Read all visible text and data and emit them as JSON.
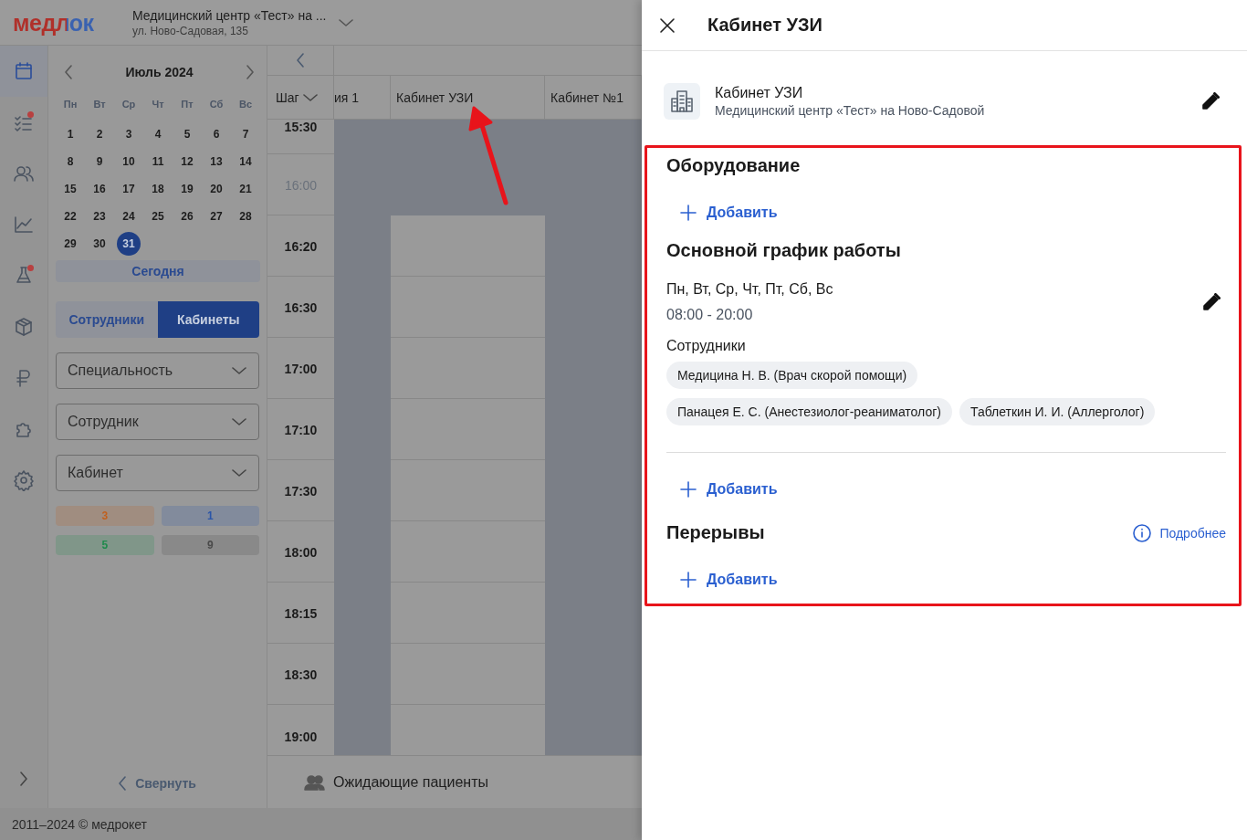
{
  "header": {
    "logo": "медлок",
    "clinic": "Медицинский центр «Тест» на ...",
    "address": "ул. Ново-Садовая, 135"
  },
  "nav_rail": [
    {
      "kind": "calendar",
      "selected": true,
      "notification": false
    },
    {
      "kind": "tasks",
      "selected": false,
      "notification": true
    },
    {
      "kind": "people",
      "selected": false,
      "notification": false
    },
    {
      "kind": "chart",
      "selected": false,
      "notification": false
    },
    {
      "kind": "flask",
      "selected": false,
      "notification": true
    },
    {
      "kind": "box",
      "selected": false,
      "notification": false
    },
    {
      "kind": "ruble",
      "selected": false,
      "notification": false
    },
    {
      "kind": "puzzle",
      "selected": false,
      "notification": false
    },
    {
      "kind": "gear",
      "selected": false,
      "notification": false
    }
  ],
  "calendar": {
    "month": "Июль 2024",
    "weekdays": [
      "Пн",
      "Вт",
      "Ср",
      "Чт",
      "Пт",
      "Сб",
      "Вс"
    ],
    "days": [
      {
        "day": "1",
        "selected": false
      },
      {
        "day": "2",
        "selected": false
      },
      {
        "day": "3",
        "selected": false
      },
      {
        "day": "4",
        "selected": false
      },
      {
        "day": "5",
        "selected": false
      },
      {
        "day": "6",
        "selected": false
      },
      {
        "day": "7",
        "selected": false
      },
      {
        "day": "8",
        "selected": false
      },
      {
        "day": "9",
        "selected": false
      },
      {
        "day": "10",
        "selected": false
      },
      {
        "day": "11",
        "selected": false
      },
      {
        "day": "12",
        "selected": false
      },
      {
        "day": "13",
        "selected": false
      },
      {
        "day": "14",
        "selected": false
      },
      {
        "day": "15",
        "selected": false
      },
      {
        "day": "16",
        "selected": false
      },
      {
        "day": "17",
        "selected": false
      },
      {
        "day": "18",
        "selected": false
      },
      {
        "day": "19",
        "selected": false
      },
      {
        "day": "20",
        "selected": false
      },
      {
        "day": "21",
        "selected": false
      },
      {
        "day": "22",
        "selected": false
      },
      {
        "day": "23",
        "selected": false
      },
      {
        "day": "24",
        "selected": false
      },
      {
        "day": "25",
        "selected": false
      },
      {
        "day": "26",
        "selected": false
      },
      {
        "day": "27",
        "selected": false
      },
      {
        "day": "28",
        "selected": false
      },
      {
        "day": "29",
        "selected": false
      },
      {
        "day": "30",
        "selected": false
      },
      {
        "day": "31",
        "selected": true
      }
    ],
    "today_button": "Сегодня"
  },
  "view_tabs": [
    {
      "label": "Сотрудники",
      "selected": false
    },
    {
      "label": "Кабинеты",
      "selected": true
    }
  ],
  "filters": [
    {
      "placeholder": "Специальность"
    },
    {
      "placeholder": "Сотрудник"
    },
    {
      "placeholder": "Кабинет"
    }
  ],
  "counters": [
    {
      "value": "3",
      "color": "#c0601e"
    },
    {
      "value": "1",
      "color": "#2a55a8"
    },
    {
      "value": "5",
      "color": "#1f8a4c"
    },
    {
      "value": "9",
      "color": "#4a4a4a"
    }
  ],
  "collapse_button": "Свернуть",
  "schedule": {
    "step": "Шаг",
    "columns": [
      "ия 1",
      "Кабинет УЗИ",
      "Кабинет №1"
    ],
    "rows": [
      {
        "time": "15:30",
        "minor": false,
        "available": [
          false,
          false,
          false
        ]
      },
      {
        "time": "16:00",
        "minor": true,
        "available": [
          false,
          false,
          false
        ]
      },
      {
        "time": "16:20",
        "minor": false,
        "available": [
          false,
          true,
          false
        ]
      },
      {
        "time": "16:30",
        "minor": false,
        "available": [
          false,
          true,
          false
        ]
      },
      {
        "time": "17:00",
        "minor": false,
        "available": [
          false,
          true,
          false
        ]
      },
      {
        "time": "17:10",
        "minor": false,
        "available": [
          false,
          true,
          false
        ]
      },
      {
        "time": "17:30",
        "minor": false,
        "available": [
          false,
          true,
          false
        ]
      },
      {
        "time": "18:00",
        "minor": false,
        "available": [
          false,
          true,
          false
        ]
      },
      {
        "time": "18:15",
        "minor": false,
        "available": [
          false,
          true,
          false
        ]
      },
      {
        "time": "18:30",
        "minor": false,
        "available": [
          false,
          true,
          false
        ]
      },
      {
        "time": "19:00",
        "minor": false,
        "available": [
          false,
          true,
          false
        ]
      }
    ]
  },
  "waiting_patients": "Ожидающие пациенты",
  "footer": "2011–2024 © медрокет",
  "drawer": {
    "title": "Кабинет УЗИ",
    "room": {
      "name": "Кабинет УЗИ",
      "clinic": "Медицинский центр «Тест» на Ново-Садовой"
    },
    "equipment": {
      "title": "Оборудование",
      "add": "Добавить"
    },
    "work_schedule": {
      "title": "Основной график работы",
      "days": "Пн, Вт, Ср, Чт, Пт, Сб, Вс",
      "hours": "08:00 - 20:00",
      "staff_label": "Сотрудники",
      "staff": [
        "Медицина Н. В. (Врач скорой помощи)",
        "Панацея Е. С. (Анестезиолог-реаниматолог)",
        "Таблеткин И. И. (Аллерголог)"
      ],
      "add": "Добавить"
    },
    "breaks": {
      "title": "Перерывы",
      "more": "Подробнее",
      "add": "Добавить"
    }
  }
}
